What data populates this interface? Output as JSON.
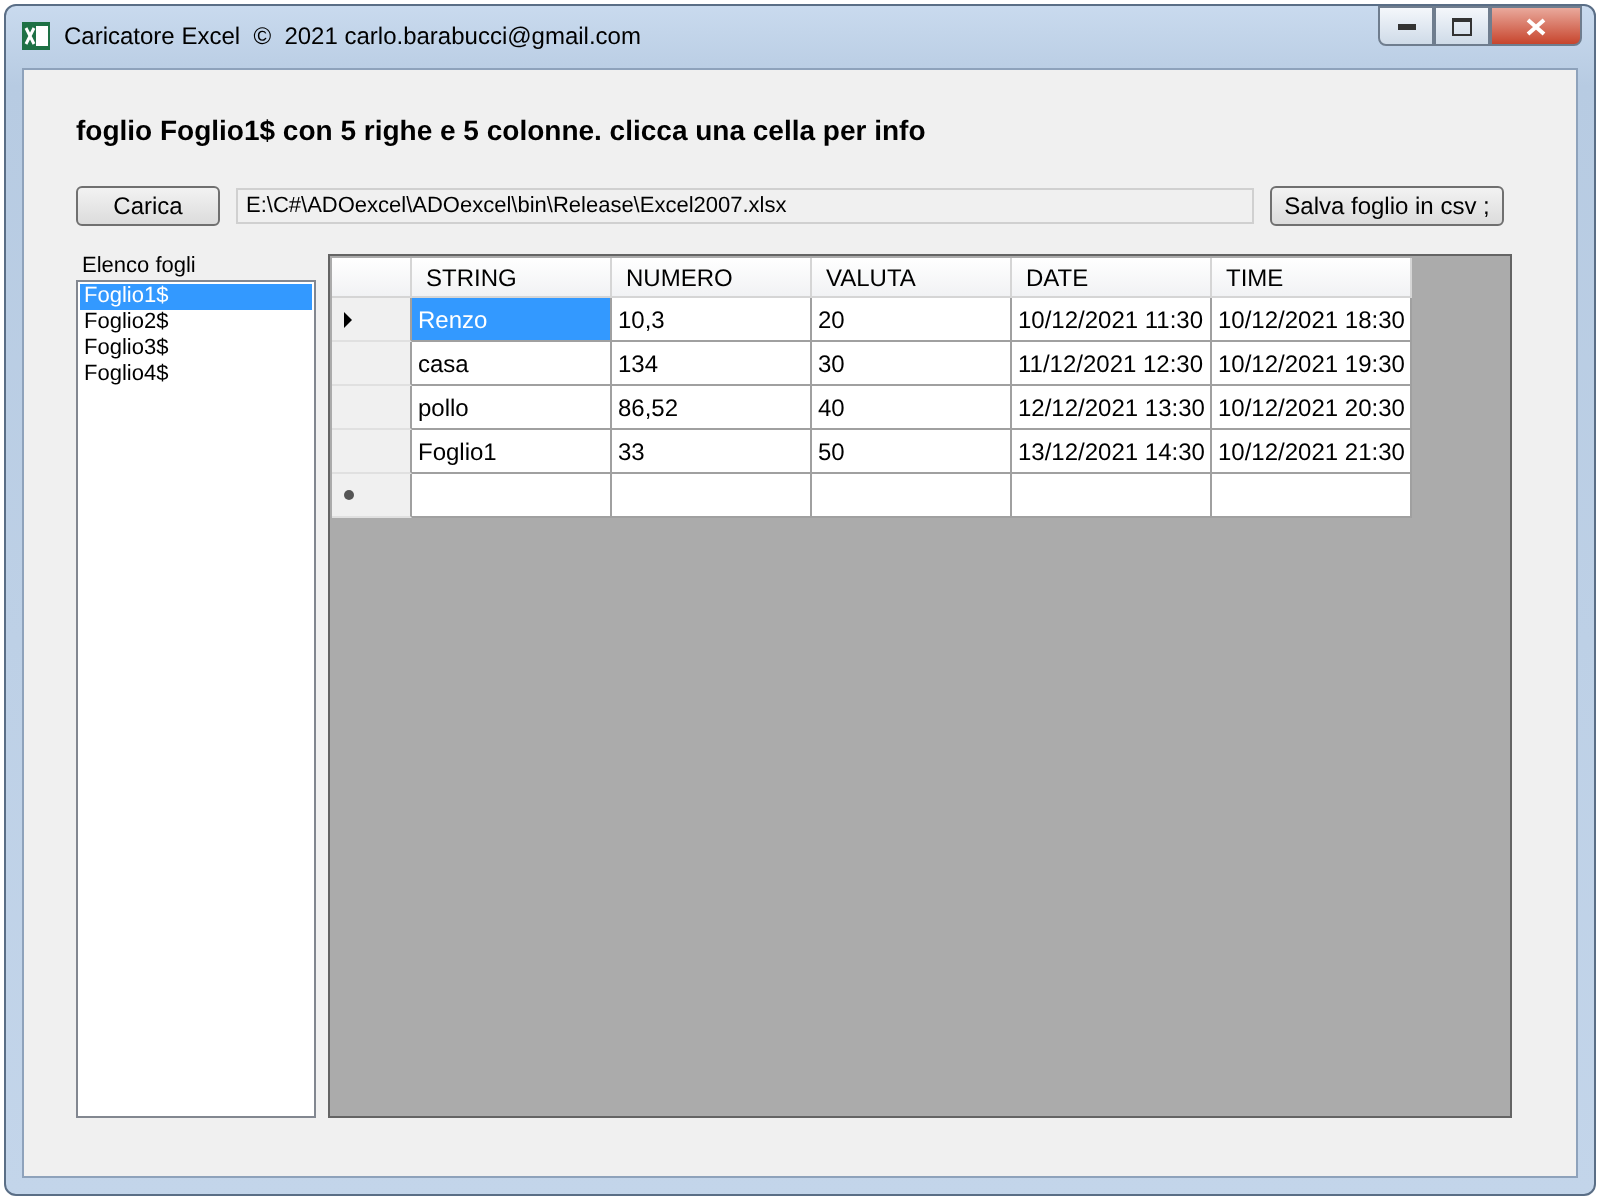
{
  "window": {
    "title": "Caricatore Excel  ©  2021 carlo.barabucci@gmail.com"
  },
  "heading": "foglio Foglio1$ con 5 righe e 5 colonne. clicca una cella per info",
  "load_button": "Carica",
  "path_field": "E:\\C#\\ADOexcel\\ADOexcel\\bin\\Release\\Excel2007.xlsx",
  "save_button": "Salva foglio in csv ;",
  "sheet_list": {
    "label": "Elenco fogli",
    "items": [
      {
        "label": "Foglio1$",
        "selected": true
      },
      {
        "label": "Foglio2$",
        "selected": false
      },
      {
        "label": "Foglio3$",
        "selected": false
      },
      {
        "label": "Foglio4$",
        "selected": false
      }
    ]
  },
  "table": {
    "columns": [
      "STRING",
      "NUMERO",
      "VALUTA",
      "DATE",
      "TIME"
    ],
    "rows": [
      {
        "kind": "data",
        "current": true,
        "cells": [
          {
            "text": "Renzo",
            "selected": true
          },
          {
            "text": "10,3",
            "selected": false
          },
          {
            "text": "20",
            "selected": false
          },
          {
            "text": "10/12/2021 11:30",
            "selected": false
          },
          {
            "text": "10/12/2021 18:30",
            "selected": false
          }
        ]
      },
      {
        "kind": "data",
        "current": false,
        "cells": [
          {
            "text": "casa",
            "selected": false
          },
          {
            "text": "134",
            "selected": false
          },
          {
            "text": "30",
            "selected": false
          },
          {
            "text": "11/12/2021 12:30",
            "selected": false
          },
          {
            "text": "10/12/2021 19:30",
            "selected": false
          }
        ]
      },
      {
        "kind": "data",
        "current": false,
        "cells": [
          {
            "text": "pollo",
            "selected": false
          },
          {
            "text": "86,52",
            "selected": false
          },
          {
            "text": "40",
            "selected": false
          },
          {
            "text": "12/12/2021 13:30",
            "selected": false
          },
          {
            "text": "10/12/2021 20:30",
            "selected": false
          }
        ]
      },
      {
        "kind": "data",
        "current": false,
        "cells": [
          {
            "text": "Foglio1",
            "selected": false
          },
          {
            "text": "33",
            "selected": false
          },
          {
            "text": "50",
            "selected": false
          },
          {
            "text": "13/12/2021 14:30",
            "selected": false
          },
          {
            "text": "10/12/2021 21:30",
            "selected": false
          }
        ]
      },
      {
        "kind": "new",
        "current": false,
        "cells": [
          {
            "text": "",
            "selected": false
          },
          {
            "text": "",
            "selected": false
          },
          {
            "text": "",
            "selected": false
          },
          {
            "text": "",
            "selected": false
          },
          {
            "text": "",
            "selected": false
          }
        ]
      }
    ]
  }
}
